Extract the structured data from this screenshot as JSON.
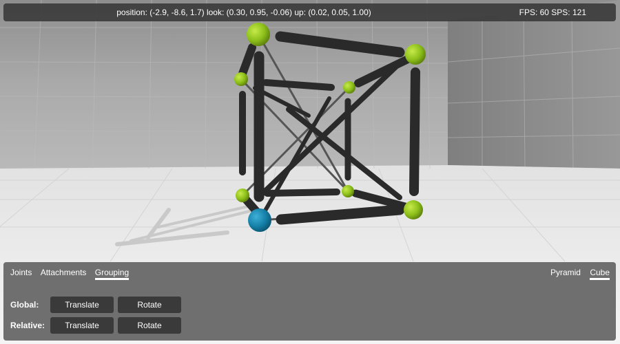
{
  "status": {
    "camera": "position: (-2.9, -8.6, 1.7) look: (0.30, 0.95, -0.06) up: (0.02, 0.05, 1.00)",
    "perf": "FPS: 60 SPS: 121"
  },
  "panel": {
    "tabs": [
      {
        "label": "Joints",
        "active": false
      },
      {
        "label": "Attachments",
        "active": false
      },
      {
        "label": "Grouping",
        "active": true
      }
    ],
    "presets": [
      {
        "label": "Pyramid",
        "active": false
      },
      {
        "label": "Cube",
        "active": true
      }
    ],
    "rows": [
      {
        "label": "Global:",
        "translate": "Translate",
        "rotate": "Rotate"
      },
      {
        "label": "Relative:",
        "translate": "Translate",
        "rotate": "Rotate"
      }
    ]
  },
  "colors": {
    "joint": "#8cbf1a",
    "selected_joint": "#1580a8",
    "strut": "#2a2a2a",
    "cable": "#555555",
    "floor": "#f1f1f1",
    "wall": "#9d9d9d",
    "panel": "#6f6f6f"
  }
}
